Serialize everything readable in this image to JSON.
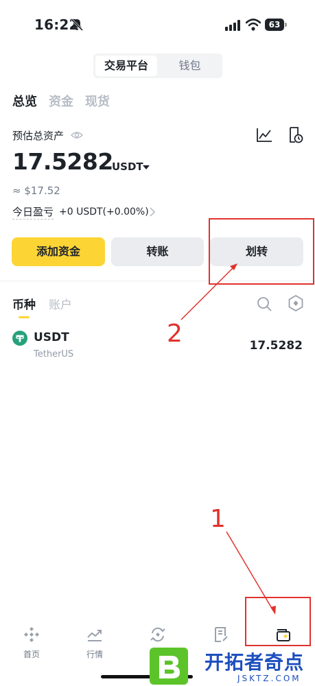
{
  "status_bar": {
    "time": "16:22",
    "battery": "63"
  },
  "segment": {
    "active": "交易平台",
    "inactive": "钱包"
  },
  "subtabs": [
    "总览",
    "资金",
    "现货"
  ],
  "assets": {
    "label": "预估总资产",
    "balance": "17.5282",
    "unit": "USDT",
    "approx": "≈ $17.52",
    "pnl_label": "今日盈亏",
    "pnl_value": "+0 USDT(+0.00%)"
  },
  "actions": {
    "add": "添加资金",
    "send": "转账",
    "transfer": "划转"
  },
  "coin_tabs": [
    "币种",
    "账户"
  ],
  "coins": [
    {
      "symbol": "USDT",
      "name": "TetherUS",
      "amount": "17.5282"
    }
  ],
  "nav": [
    {
      "label": "首页",
      "icon": "home-icon"
    },
    {
      "label": "行情",
      "icon": "markets-icon"
    },
    {
      "label": "",
      "icon": "trade-icon"
    },
    {
      "label": "",
      "icon": "orders-icon"
    },
    {
      "label": "",
      "icon": "wallet-icon"
    }
  ],
  "annotations": {
    "step1": "1",
    "step2": "2",
    "arrow_color": "#e0322c"
  },
  "watermark": {
    "title": "开拓者奇点",
    "url": "JSKTZ.COM"
  },
  "colors": {
    "accent": "#fcd535",
    "text": "#1e2329",
    "muted": "#707a8a",
    "usdt": "#26a17b"
  }
}
